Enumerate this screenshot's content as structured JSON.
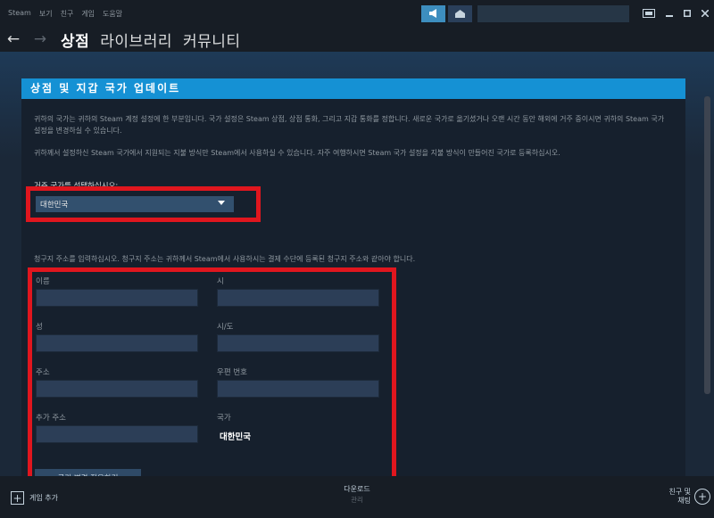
{
  "menu": [
    "Steam",
    "보기",
    "친구",
    "게임",
    "도움말"
  ],
  "nav": {
    "back": "←",
    "forward": "→",
    "tabs": [
      "상점",
      "라이브러리",
      "커뮤니티"
    ]
  },
  "panel": {
    "title": "상점 및 지갑 국가 업데이트",
    "para1": "귀하의 국가는 귀하의 Steam 계정 설정에 한 부분입니다. 국가 설정은 Steam 상점, 상점 통화, 그리고 지갑 통화를 정합니다. 새로운 국가로 옮기셨거나 오랜 시간 동안 해외에 거주 중이시면 귀하의 Steam 국가 설정을 변경하실 수 있습니다.",
    "para2": "귀하께서 설정하신 Steam 국가에서 지원되는 지불 방식만 Steam에서 사용하실 수 있습니다. 자주 여행하시면 Steam 국가 설정을 지불 방식이 만들어진 국가로 등록하십시오.",
    "select_label": "거주 국가를 선택하십시오:",
    "selected_country": "대한민국",
    "billing_note": "청구지 주소를 입력하십시오. 청구지 주소는 귀하께서 Steam에서 사용하시는 결제 수단에 등록된 청구지 주소와 같아야 합니다.",
    "fields": {
      "first_name": "이름",
      "city": "시",
      "last_name": "성",
      "state": "시/도",
      "address": "주소",
      "postal": "우편 번호",
      "address2": "추가 주소",
      "country": "국가"
    },
    "country_value": "대한민국",
    "apply": "국가 변경 적용하기"
  },
  "bottom": {
    "add_game": "게임 추가",
    "downloads": "다운로드",
    "manage": "관리",
    "friends": "친구 및 채팅"
  },
  "colors": {
    "highlight": "#e0161e",
    "header": "#1591d4"
  }
}
